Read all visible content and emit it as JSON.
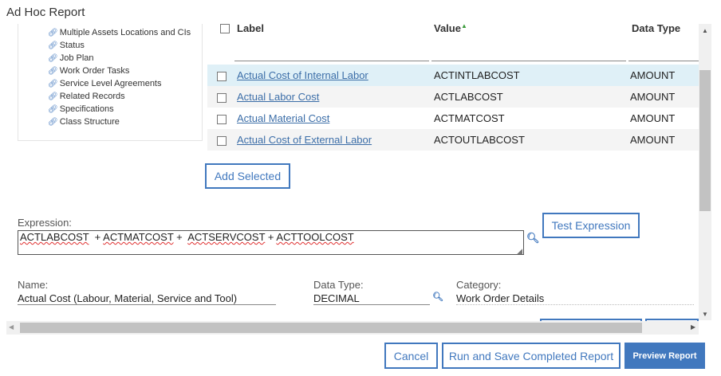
{
  "dialog": {
    "title": "Ad Hoc Report"
  },
  "tree": {
    "items": [
      "Multiple Assets Locations and CIs",
      "Status",
      "Job Plan",
      "Work Order Tasks",
      "Service Level Agreements",
      "Related Records",
      "Specifications",
      "Class Structure"
    ]
  },
  "table": {
    "headers": {
      "label": "Label",
      "value": "Value",
      "data_type": "Data Type"
    },
    "sort_indicator": "▲",
    "rows": [
      {
        "label": "Actual Cost of Internal Labor",
        "value": "ACTINTLABCOST",
        "data_type": "AMOUNT"
      },
      {
        "label": "Actual Labor Cost",
        "value": "ACTLABCOST",
        "data_type": "AMOUNT"
      },
      {
        "label": "Actual Material Cost",
        "value": "ACTMATCOST",
        "data_type": "AMOUNT"
      },
      {
        "label": "Actual Cost of External Labor",
        "value": "ACTOUTLABCOST",
        "data_type": "AMOUNT"
      }
    ],
    "add_selected": "Add Selected"
  },
  "expression": {
    "label": "Expression:",
    "tokens": [
      "ACTLABCOST",
      "  + ",
      "ACTMATCOST",
      " +  ",
      "ACTSERVCOST",
      " + ",
      "ACTTOOLCOST"
    ],
    "test_button": "Test Expression"
  },
  "fields": {
    "name_label": "Name:",
    "name_value": "Actual Cost (Labour, Material, Service and Tool)",
    "datatype_label": "Data Type:",
    "datatype_value": "DECIMAL",
    "category_label": "Category:",
    "category_value": "Work Order Details"
  },
  "footer": {
    "cancel": "Cancel",
    "run_save": "Run and Save Completed Report",
    "preview": "Preview Report"
  },
  "colors": {
    "accent": "#4178be",
    "row_selected": "#dff0f7",
    "row_alt": "#f4f4f4"
  }
}
